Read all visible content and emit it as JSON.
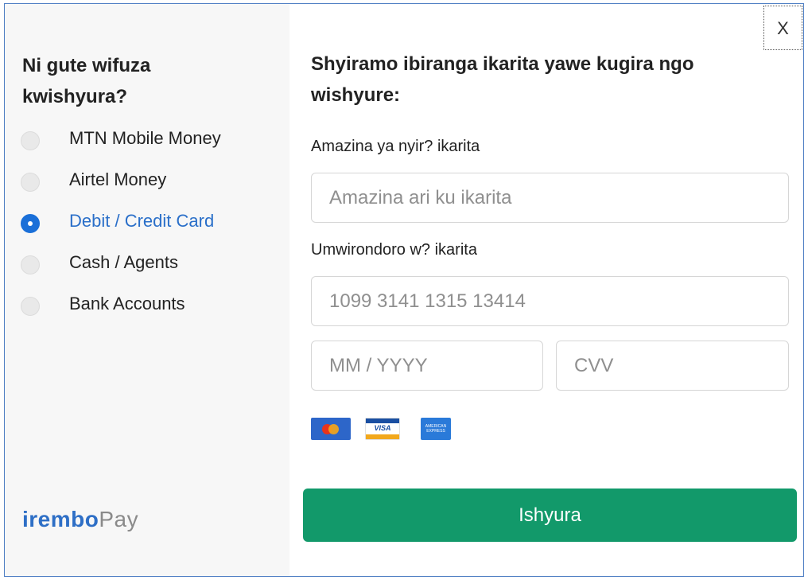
{
  "sidebar": {
    "title": "Ni gute wifuza kwishyura?",
    "methods": [
      {
        "label": "MTN Mobile Money",
        "selected": false
      },
      {
        "label": "Airtel Money",
        "selected": false
      },
      {
        "label": "Debit / Credit Card",
        "selected": true
      },
      {
        "label": "Cash / Agents",
        "selected": false
      },
      {
        "label": "Bank Accounts",
        "selected": false
      }
    ],
    "logo": {
      "brand": "irembo",
      "suffix": "Pay"
    }
  },
  "close_label": "X",
  "form": {
    "title": "Shyiramo ibiranga ikarita yawe kugira ngo wishyure:",
    "name_label": "Amazina ya nyir? ikarita",
    "name_placeholder": "Amazina ari ku ikarita",
    "number_label": "Umwirondoro w? ikarita",
    "number_placeholder": "1099 3141 1315 13414",
    "expiry_placeholder": "MM / YYYY",
    "cvv_placeholder": "CVV",
    "card_logos": [
      {
        "name": "mastercard-icon"
      },
      {
        "name": "visa-icon",
        "text": "VISA"
      },
      {
        "name": "amex-icon",
        "text": "AMERICAN EXPRESS"
      }
    ],
    "submit_label": "Ishyura"
  },
  "colors": {
    "accent_blue": "#1a6fd8",
    "pay_green": "#12996a",
    "frame_border": "#4f7fc4",
    "sidebar_bg": "#f7f7f7"
  }
}
